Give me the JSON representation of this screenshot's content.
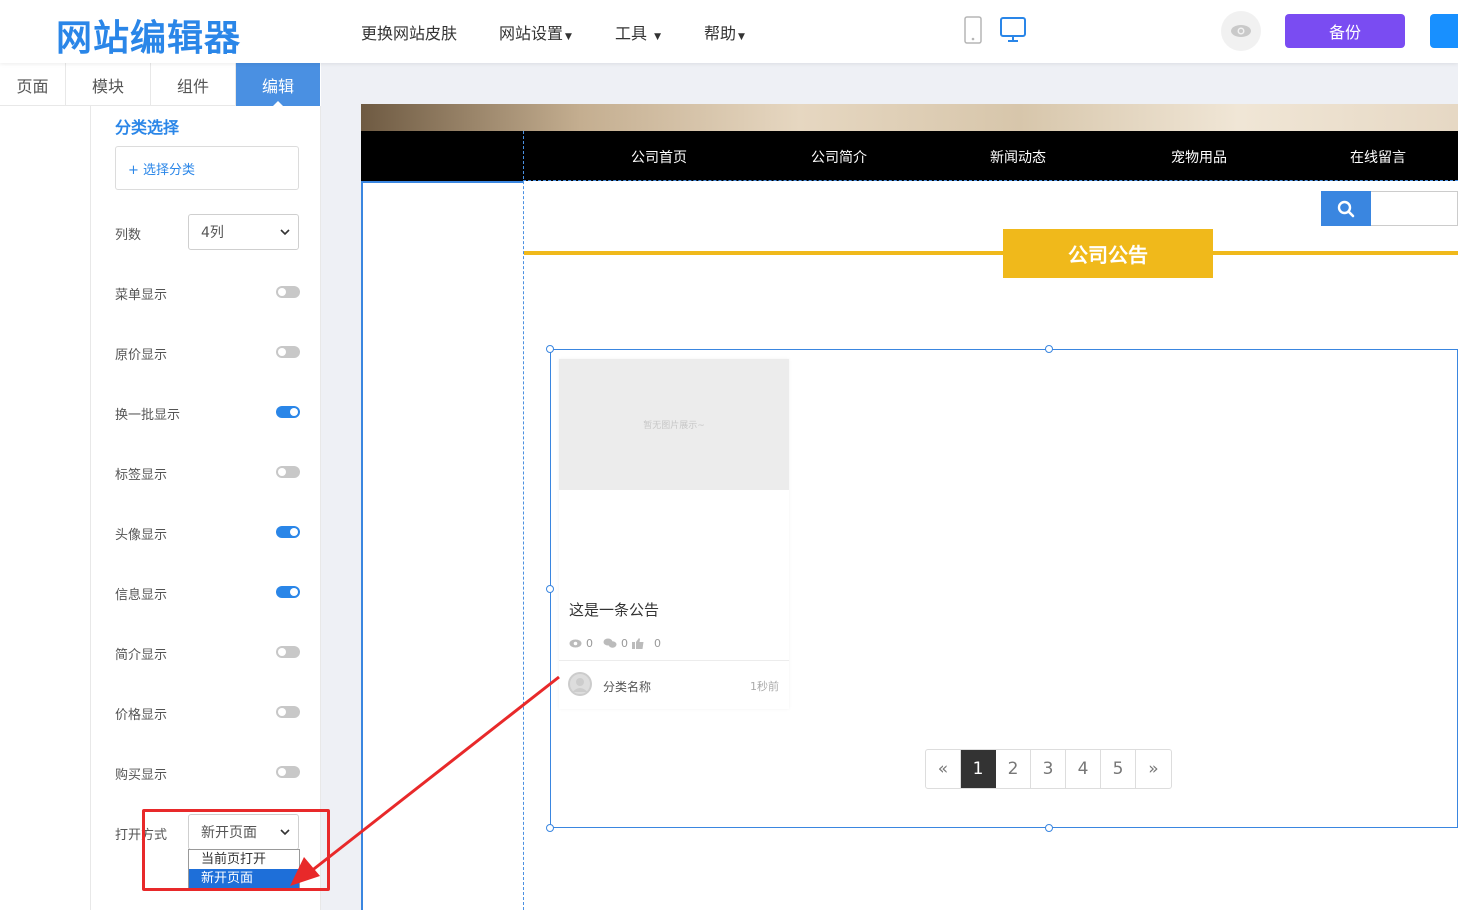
{
  "header": {
    "logo": "网站编辑器",
    "menu": [
      {
        "label": "更换网站皮肤"
      },
      {
        "label": "网站设置"
      },
      {
        "label": "工具"
      },
      {
        "label": "帮助"
      }
    ],
    "backup_label": "备份"
  },
  "tabs": [
    {
      "label": "页面"
    },
    {
      "label": "模块"
    },
    {
      "label": "组件"
    },
    {
      "label": "编辑",
      "active": true
    }
  ],
  "panel": {
    "title": "分类选择",
    "select_category_label": "+ 选择分类",
    "columns_label": "列数",
    "columns_value": "4列",
    "toggles": [
      {
        "label": "菜单显示",
        "on": false
      },
      {
        "label": "原价显示",
        "on": false
      },
      {
        "label": "换一批显示",
        "on": true
      },
      {
        "label": "标签显示",
        "on": false
      },
      {
        "label": "头像显示",
        "on": true
      },
      {
        "label": "信息显示",
        "on": true
      },
      {
        "label": "简介显示",
        "on": false
      },
      {
        "label": "价格显示",
        "on": false
      },
      {
        "label": "购买显示",
        "on": false
      }
    ],
    "open_mode_label": "打开方式",
    "open_mode_value": "新开页面",
    "open_mode_options": [
      "当前页打开",
      "新开页面"
    ]
  },
  "site": {
    "nav": [
      "公司首页",
      "公司简介",
      "新闻动态",
      "宠物用品",
      "在线留言"
    ],
    "section_title": "公司公告",
    "card": {
      "image_placeholder": "暂无图片展示~",
      "title": "这是一条公告",
      "views": "0",
      "comments": "0",
      "likes": "0",
      "category": "分类名称",
      "time": "1秒前"
    },
    "pagination": [
      "«",
      "1",
      "2",
      "3",
      "4",
      "5",
      "»"
    ],
    "pagination_active": "1"
  },
  "colors": {
    "brand_blue": "#2a86e8",
    "backup_purple": "#7a4cf2",
    "title_yellow": "#f0b91b",
    "annotation_red": "#e8292a"
  }
}
